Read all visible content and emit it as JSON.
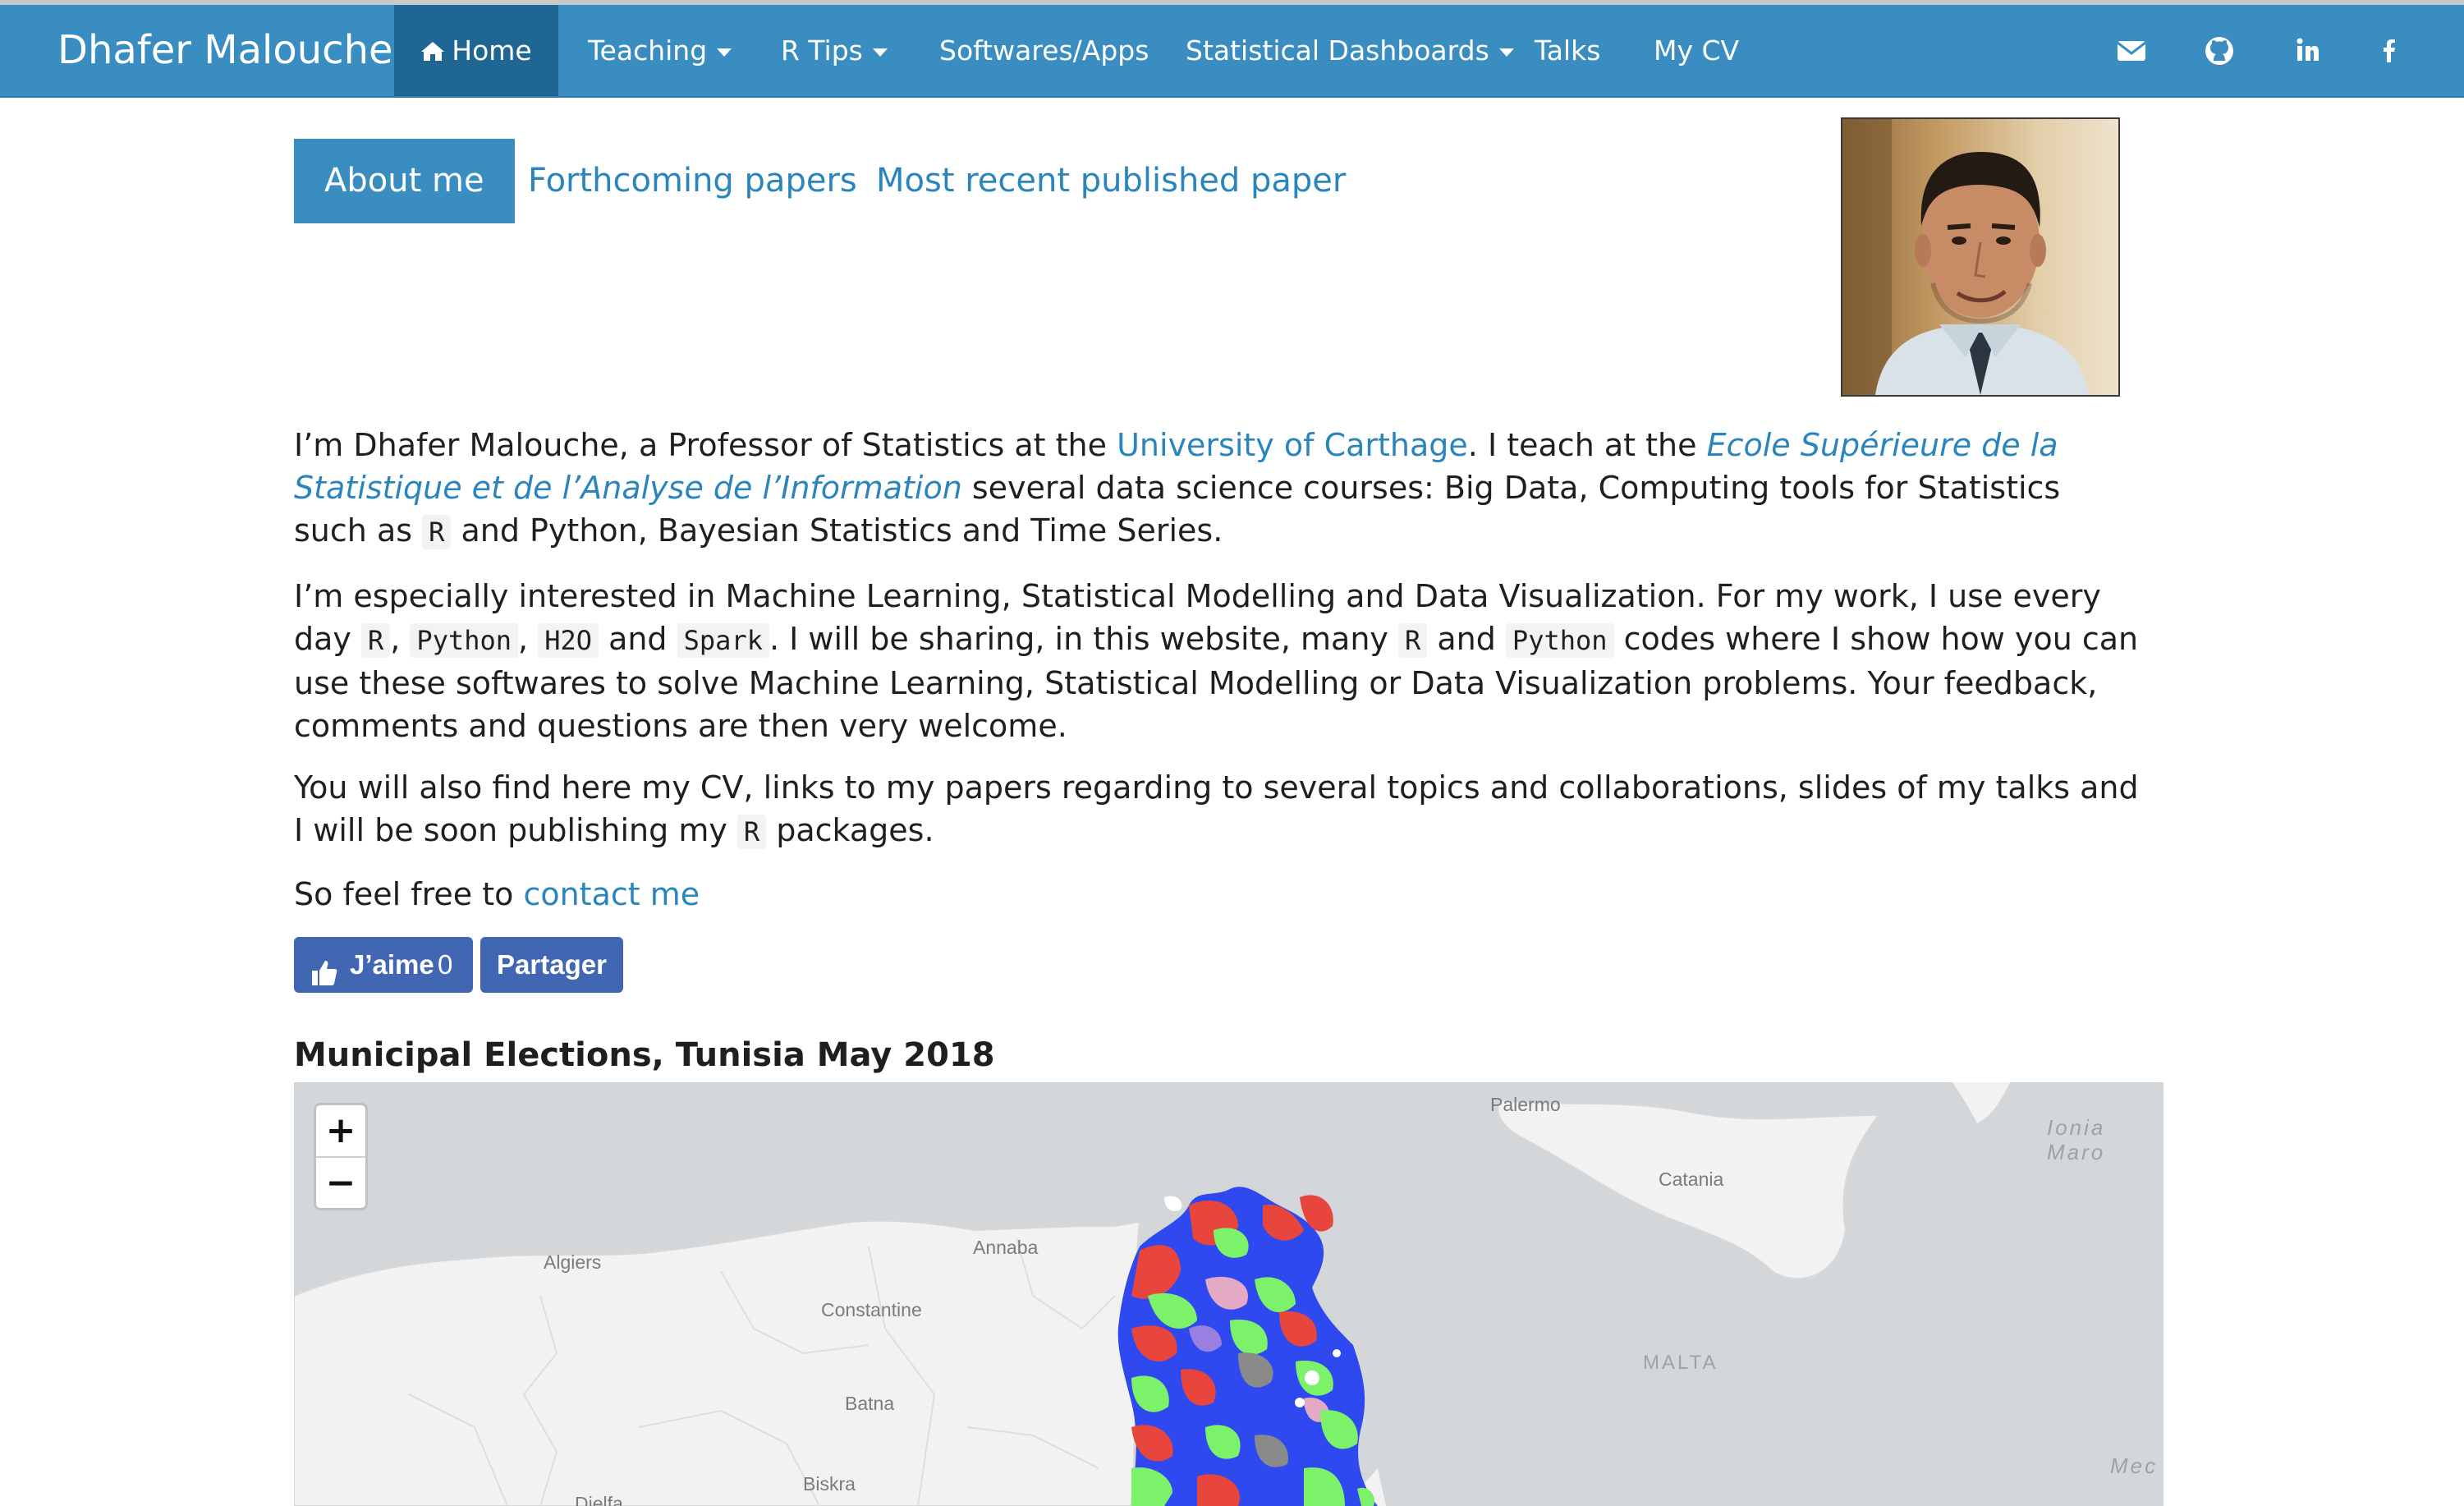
{
  "navbar": {
    "brand": "Dhafer Malouche",
    "items": [
      {
        "label": "Home",
        "icon": "home-icon",
        "active": true
      },
      {
        "label": "Teaching",
        "dropdown": true
      },
      {
        "label": "R Tips",
        "dropdown": true
      },
      {
        "label": "Softwares/Apps"
      },
      {
        "label": "Statistical Dashboards",
        "dropdown": true
      },
      {
        "label": "Talks"
      },
      {
        "label": "My CV"
      }
    ],
    "social_icons": [
      "envelope-icon",
      "github-icon",
      "linkedin-icon",
      "facebook-icon"
    ],
    "colors": {
      "bar": "#3a8dc0",
      "active": "#1f6694"
    }
  },
  "tabs": [
    {
      "label": "About me",
      "active": true
    },
    {
      "label": "Forthcoming papers"
    },
    {
      "label": "Most recent published paper"
    }
  ],
  "intro": {
    "p1": {
      "t1": "I’m Dhafer Malouche, a Professor of Statistics at the ",
      "link1": "University of Carthage",
      "t2": ". I teach at the ",
      "link2": "Ecole Supérieure de la Statistique et de l’Analyse de l’Information",
      "t3": " several data science courses: Big Data, Computing tools for Statistics such as ",
      "code1": "R",
      "t4": " and Python, Bayesian Statistics and Time Series."
    },
    "p2": {
      "t1": "I’m especially interested in Machine Learning, Statistical Modelling and Data Visualization. For my work, I use every day ",
      "code_r": "R",
      "comma1": ", ",
      "code_python": "Python",
      "comma2": ", ",
      "code_h2o": "H2O",
      "and1": " and ",
      "code_spark": "Spark",
      "t2": ". I will be sharing, in this website, many ",
      "code_r2": "R",
      "and2": " and ",
      "code_python2": "Python",
      "t3": " codes where I show how you can use these softwares to solve Machine Learning, Statistical Modelling or Data Visualization problems. Your feedback, comments and questions are then very welcome."
    },
    "p3": {
      "t1": "You will also find here my CV, links to my papers regarding to several topics and collaborations, slides of my talks and I will be soon publishing my ",
      "code1": "R",
      "t2": " packages."
    },
    "p4": {
      "t1": "So feel free to ",
      "link1": "contact me"
    }
  },
  "facebook": {
    "like_label": "J’aime",
    "like_count": "0",
    "share_label": "Partager",
    "like_icon": "thumbs-up-icon",
    "color": "#4267b2"
  },
  "map_section": {
    "title": "Municipal Elections, Tunisia May 2018",
    "zoom_in": "+",
    "zoom_out": "−",
    "cities": {
      "palermo": "Palermo",
      "catania": "Catania",
      "algiers": "Algiers",
      "annaba": "Annaba",
      "constantine": "Constantine",
      "batna": "Batna",
      "biskra": "Biskra",
      "djelfa": "Djelfa"
    },
    "malta": "MALTA",
    "ionian": "Ionia\nMaro",
    "med": "Mec",
    "party_colors": [
      "#e8453c",
      "#2f49f0",
      "#7cf26a",
      "#9b7fe0",
      "#e4a9c4",
      "#8a8a8a",
      "#ffffff"
    ]
  }
}
